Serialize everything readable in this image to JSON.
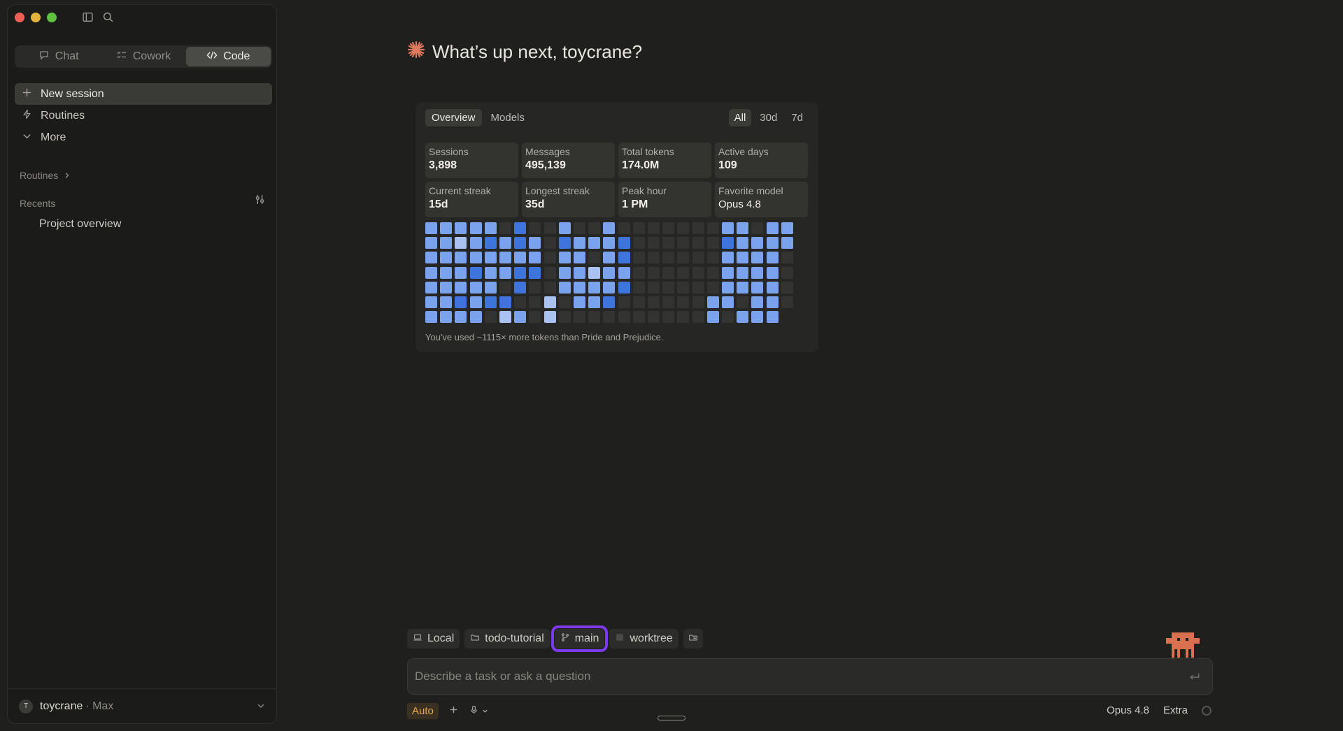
{
  "sidebar": {
    "modes": [
      {
        "label": "Chat",
        "icon": "chat-icon",
        "active": false
      },
      {
        "label": "Cowork",
        "icon": "checklist-icon",
        "active": false
      },
      {
        "label": "Code",
        "icon": "code-icon",
        "active": true
      }
    ],
    "nav": [
      {
        "label": "New session",
        "icon": "plus-icon"
      },
      {
        "label": "Routines",
        "icon": "bolt-icon"
      },
      {
        "label": "More",
        "icon": "chevron-down-icon"
      }
    ],
    "routines_label": "Routines",
    "recents_label": "Recents",
    "recents": [
      "Project overview"
    ],
    "account": {
      "initial": "T",
      "name": "toycrane",
      "plan": "· Max"
    }
  },
  "main": {
    "greeting": "What’s up next, toycrane?",
    "accent_color": "#e07a5f"
  },
  "stats": {
    "tabs": [
      "Overview",
      "Models"
    ],
    "active_tab": "Overview",
    "ranges": [
      "All",
      "30d",
      "7d"
    ],
    "active_range": "All",
    "cards": [
      {
        "label": "Sessions",
        "value": "3,898"
      },
      {
        "label": "Messages",
        "value": "495,139"
      },
      {
        "label": "Total tokens",
        "value": "174.0M"
      },
      {
        "label": "Active days",
        "value": "109"
      },
      {
        "label": "Current streak",
        "value": "15d"
      },
      {
        "label": "Longest streak",
        "value": "35d"
      },
      {
        "label": "Peak hour",
        "value": "1 PM"
      },
      {
        "label": "Favorite model",
        "value": "Opus 4.8"
      }
    ],
    "heatmap_levels": [
      [
        2,
        2,
        2,
        2,
        2,
        0,
        3,
        0,
        0,
        2,
        0,
        0,
        2,
        0,
        0,
        0,
        0,
        0,
        0,
        0,
        2,
        2,
        0,
        2,
        2
      ],
      [
        2,
        2,
        1,
        2,
        3,
        2,
        3,
        2,
        0,
        3,
        2,
        2,
        2,
        3,
        0,
        0,
        0,
        0,
        0,
        0,
        3,
        2,
        2,
        2,
        2
      ],
      [
        2,
        2,
        2,
        2,
        2,
        2,
        2,
        2,
        0,
        2,
        2,
        0,
        2,
        3,
        0,
        0,
        0,
        0,
        0,
        0,
        2,
        2,
        2,
        2,
        0
      ],
      [
        2,
        2,
        2,
        3,
        2,
        2,
        3,
        3,
        0,
        2,
        2,
        1,
        2,
        2,
        0,
        0,
        0,
        0,
        0,
        0,
        2,
        2,
        2,
        2,
        0
      ],
      [
        2,
        2,
        2,
        2,
        2,
        0,
        3,
        0,
        0,
        2,
        2,
        2,
        2,
        3,
        0,
        0,
        0,
        0,
        0,
        0,
        2,
        2,
        2,
        2,
        0
      ],
      [
        2,
        2,
        3,
        2,
        3,
        3,
        0,
        0,
        1,
        0,
        2,
        2,
        3,
        0,
        0,
        0,
        0,
        0,
        0,
        2,
        2,
        0,
        2,
        2,
        0
      ],
      [
        2,
        2,
        2,
        2,
        0,
        1,
        2,
        0,
        1,
        0,
        0,
        0,
        0,
        0,
        0,
        0,
        0,
        0,
        0,
        2,
        0,
        2,
        2,
        2,
        -1
      ]
    ],
    "heatmap_colors": [
      "#333331",
      "#a9c2f2",
      "#7ba2ec",
      "#3f74dd"
    ],
    "footnote": "You've used ~1115× more tokens than Pride and Prejudice."
  },
  "composer": {
    "chips": [
      {
        "label": "Local",
        "icon": "laptop-icon"
      },
      {
        "label": "todo-tutorial",
        "icon": "folder-icon"
      },
      {
        "label": "main",
        "icon": "branch-icon"
      },
      {
        "label": "worktree",
        "icon": "checkbox-icon"
      }
    ],
    "placeholder": "Describe a task or ask a question",
    "value": "",
    "mode_badge": "Auto",
    "model": "Opus 4.8",
    "effort": "Extra"
  }
}
